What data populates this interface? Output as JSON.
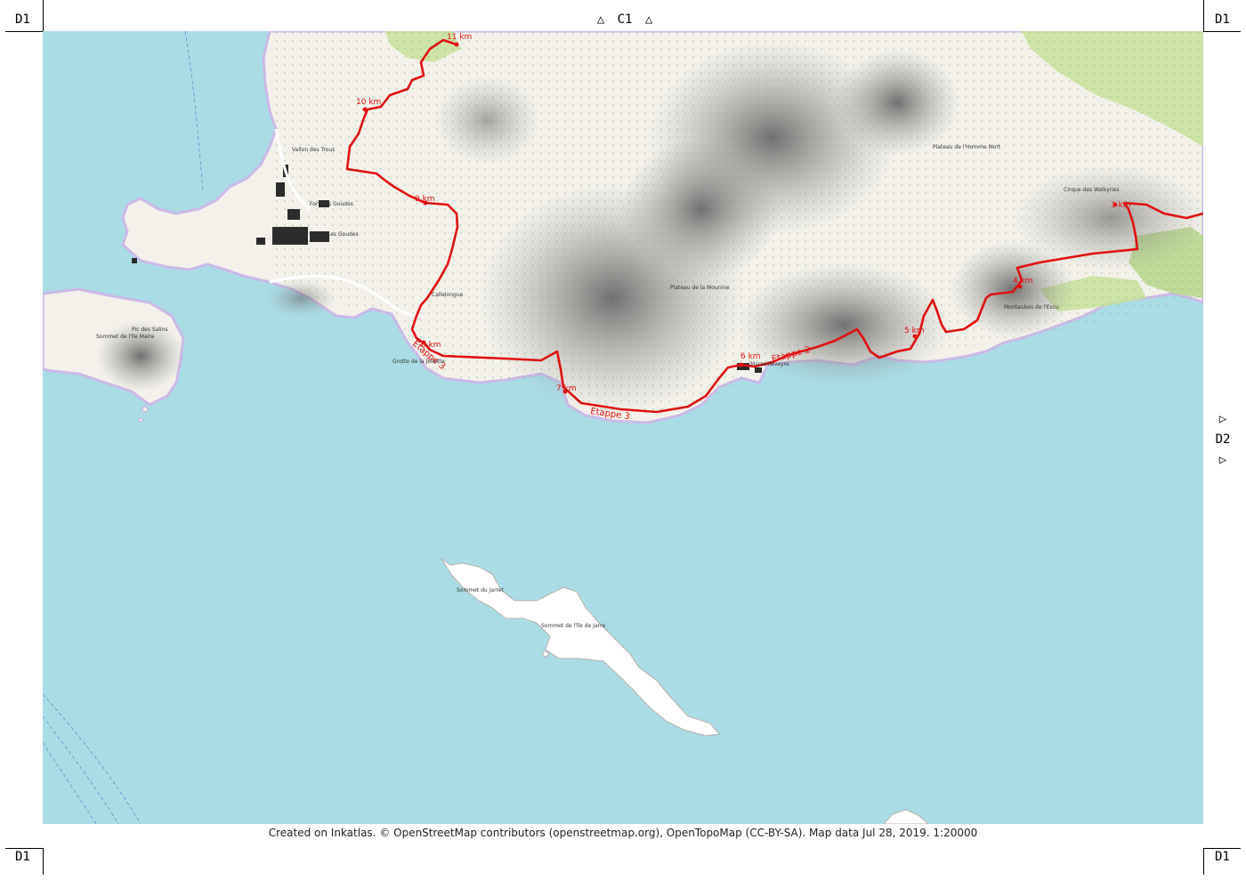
{
  "corners": {
    "top_left": "D1",
    "top_right": "D1",
    "bottom_left": "D1",
    "bottom_right": "D1"
  },
  "nav": {
    "top": {
      "label": "C1",
      "arrow": "△"
    },
    "right": {
      "label": "D2",
      "arrow": "▷"
    }
  },
  "km_markers": [
    "11 km",
    "10 km",
    "9 km",
    "8 km",
    "7 km",
    "6 km",
    "5 km",
    "4 km",
    "3 km"
  ],
  "etapes": [
    "Etappe 3",
    "Etappe 3",
    "Etappe 2"
  ],
  "places": {
    "marseilleveyre": "Marseilleveyre",
    "callelongue": "Callelongue",
    "les_goudes": "Les Goudes",
    "fort": "Fort des Goudes",
    "vallon_trous": "Vallon des Trous",
    "maire": "Sommet de l'île Maïre",
    "jarre": "Sommet de l'île de Jarre",
    "jarre_sub": "Sommet du Jarret",
    "pic_salins": "Pic des Salins",
    "plateau": "Plateau de la Mounine",
    "homme_mort": "Plateau de l'Homme Mort",
    "cirque": "Cirque des Walkyries",
    "grotte": "Grotte de la Joliette",
    "escu": "Montaubes de l'Escu"
  },
  "credit": "Created on Inkatlas. © OpenStreetMap contributors (openstreetmap.org), OpenTopoMap (CC-BY-SA). Map data Jul 28, 2019. 1:20000",
  "colors": {
    "sea": "#aadce6",
    "land": "#f3f1ea",
    "route": "#e01010",
    "hill_shadow": "#6e6e6e",
    "vegetation": "#c7e29a"
  }
}
